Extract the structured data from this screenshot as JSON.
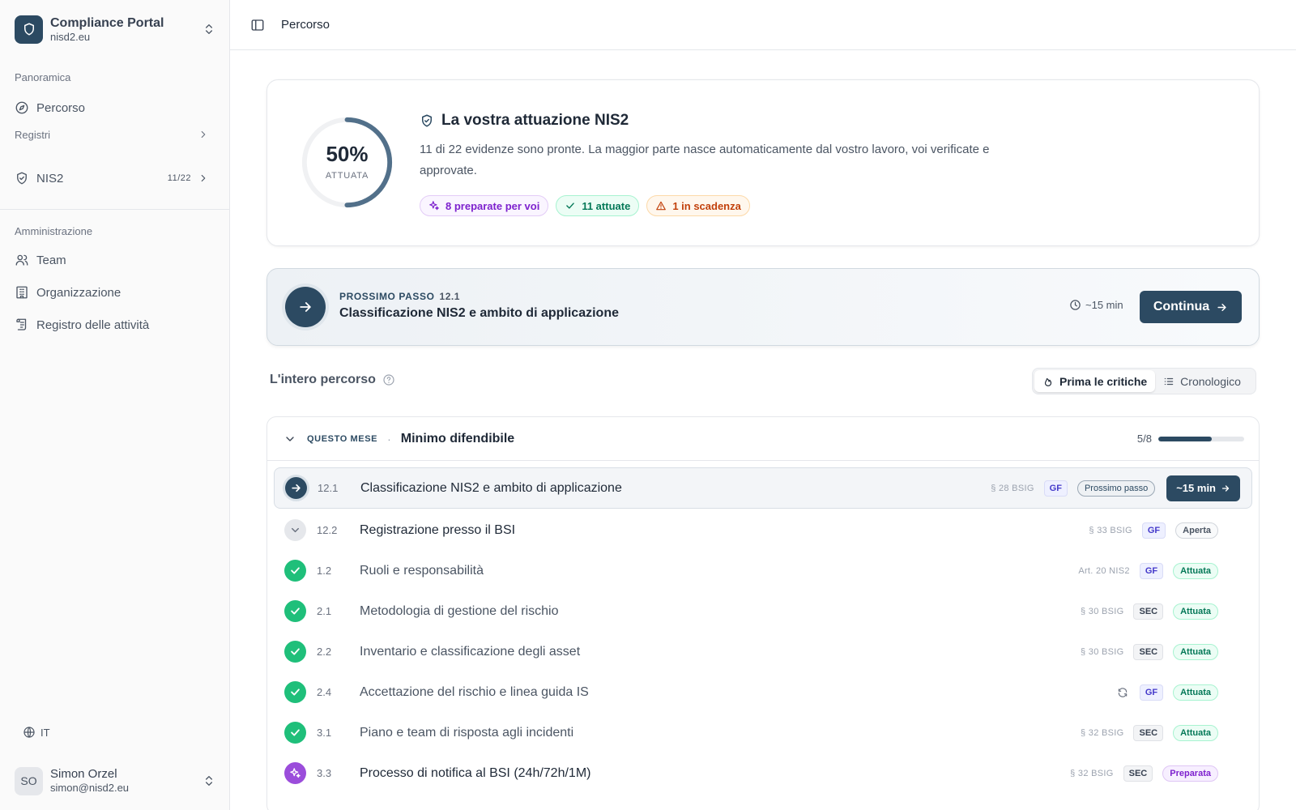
{
  "sidebar": {
    "brand": {
      "title": "Compliance Portal",
      "subtitle": "nisd2.eu"
    },
    "section_overview": "Panoramica",
    "nav_path": "Percorso",
    "section_registers": "Registri",
    "nis2": {
      "label": "NIS2",
      "count": "11/22"
    },
    "section_admin": "Amministrazione",
    "nav_team": "Team",
    "nav_org": "Organizzazione",
    "nav_activity": "Registro delle attività",
    "language": "IT",
    "user": {
      "initials": "SO",
      "name": "Simon Orzel",
      "email": "simon@nisd2.eu"
    }
  },
  "topbar": {
    "title": "Percorso"
  },
  "progress_card": {
    "percent": "50%",
    "percent_value": 50,
    "percent_label": "ATTUATA",
    "title": "La vostra attuazione NIS2",
    "description": "11 di 22 evidenze sono pronte. La maggior parte nasce automaticamente dal vostro lavoro, voi verificate e approvate.",
    "pill_prepared": "8 preparate per voi",
    "pill_done": "11 attuate",
    "pill_due": "1 in scadenza"
  },
  "next_step": {
    "kicker": "PROSSIMO PASSO",
    "number": "12.1",
    "title": "Classificazione NIS2 e ambito di applicazione",
    "time": "~15 min",
    "button": "Continua"
  },
  "journey": {
    "title": "L'intero percorso",
    "sort_critical": "Prima le critiche",
    "sort_chrono": "Cronologico"
  },
  "phase": {
    "kicker": "QUESTO MESE",
    "separator": "·",
    "title": "Minimo difendibile",
    "progress": "5/8",
    "progress_fraction": 0.625
  },
  "rows": [
    {
      "num": "12.1",
      "title": "Classificazione NIS2 e ambito di applicazione",
      "ref": "§ 28 BSIG",
      "tag": "GF",
      "status": "Prossimo passo",
      "action": "~15 min"
    },
    {
      "num": "12.2",
      "title": "Registrazione presso il BSI",
      "ref": "§ 33 BSIG",
      "tag": "GF",
      "status": "Aperta"
    },
    {
      "num": "1.2",
      "title": "Ruoli e responsabilità",
      "ref": "Art. 20 NIS2",
      "tag": "GF",
      "status": "Attuata"
    },
    {
      "num": "2.1",
      "title": "Metodologia di gestione del rischio",
      "ref": "§ 30 BSIG",
      "tag": "SEC",
      "status": "Attuata"
    },
    {
      "num": "2.2",
      "title": "Inventario e classificazione degli asset",
      "ref": "§ 30 BSIG",
      "tag": "SEC",
      "status": "Attuata"
    },
    {
      "num": "2.4",
      "title": "Accettazione del rischio e linea guida IS",
      "ref": "",
      "tag": "GF",
      "status": "Attuata"
    },
    {
      "num": "3.1",
      "title": "Piano e team di risposta agli incidenti",
      "ref": "§ 32 BSIG",
      "tag": "SEC",
      "status": "Attuata"
    },
    {
      "num": "3.3",
      "title": "Processo di notifica al BSI (24h/72h/1M)",
      "ref": "§ 32 BSIG",
      "tag": "SEC",
      "status": "Preparata"
    }
  ],
  "colors": {
    "brand": "#2c4a62",
    "done": "#1fbf7a",
    "prepared": "#9b4ddb",
    "warning": "#c2410c"
  },
  "icons": [
    "shield-icon",
    "updown-icon",
    "compass-icon",
    "chevron-right-icon",
    "users-icon",
    "building-icon",
    "scroll-icon",
    "globe-icon",
    "sidebar-toggle-icon",
    "sparkles-icon",
    "check-icon",
    "warning-icon",
    "arrow-right-icon",
    "clock-icon",
    "help-icon",
    "flame-icon",
    "list-icon",
    "chevron-down-icon",
    "refresh-icon"
  ]
}
